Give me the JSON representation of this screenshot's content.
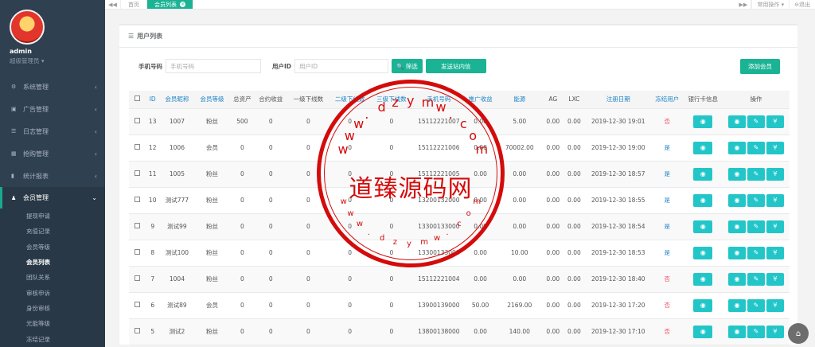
{
  "sidebar": {
    "user": {
      "name": "admin",
      "role": "超级管理员 ▾"
    },
    "nav": [
      {
        "label": "系统管理",
        "icon": "gear-icon",
        "glyph": "⚙",
        "arrow": "‹"
      },
      {
        "label": "广告管理",
        "icon": "image-icon",
        "glyph": "▣",
        "arrow": "‹"
      },
      {
        "label": "日志管理",
        "icon": "list-icon",
        "glyph": "☰",
        "arrow": "‹"
      },
      {
        "label": "抢购管理",
        "icon": "grid-icon",
        "glyph": "▦",
        "arrow": "‹"
      },
      {
        "label": "统计报表",
        "icon": "bar-chart-icon",
        "glyph": "▮",
        "arrow": "‹"
      },
      {
        "label": "会员管理",
        "icon": "user-icon",
        "glyph": "♟",
        "arrow": "⌄"
      }
    ],
    "sub": [
      "提现申请",
      "充值记录",
      "会员等级",
      "会员列表",
      "团队关系",
      "审核申诉",
      "身份审核",
      "光能等级",
      "冻结记录"
    ]
  },
  "topbar": {
    "back": "◀◀",
    "tabs": [
      "首页",
      "会员列表"
    ],
    "forward": "▶▶",
    "ops": "常用操作 ▾",
    "logout": "⊖退出"
  },
  "panel": {
    "title": "用户列表",
    "icon": "☰"
  },
  "filter": {
    "phone_label": "手机号码",
    "phone_placeholder": "手机号码",
    "uid_label": "用户ID",
    "uid_placeholder": "用户ID",
    "search_btn": "🔍 筛选",
    "send_btn": "发送站内信",
    "add_btn": "添加会员"
  },
  "table": {
    "headers": [
      "",
      "ID",
      "会员昵称",
      "会员等级",
      "总资产",
      "合约收益",
      "一级下线数",
      "二级下线数",
      "三级下线数",
      "手机号码",
      "推广收益",
      "能源",
      "AG",
      "LXC",
      "注册日期",
      "冻结用户",
      "银行卡信息",
      "操作"
    ],
    "rows": [
      [
        "13",
        "1007",
        "粉丝",
        "500",
        "0",
        "0",
        "0",
        "0",
        "15112221007",
        "0.00",
        "5.00",
        "0.00",
        "0.00",
        "2019-12-30 19:01",
        "否"
      ],
      [
        "12",
        "1006",
        "会员",
        "0",
        "0",
        "0",
        "0",
        "0",
        "15112221006",
        "0.00",
        "70002.00",
        "0.00",
        "0.00",
        "2019-12-30 19:00",
        "是"
      ],
      [
        "11",
        "1005",
        "粉丝",
        "0",
        "0",
        "0",
        "0",
        "0",
        "15112221005",
        "0.00",
        "0.00",
        "0.00",
        "0.00",
        "2019-12-30 18:57",
        "是"
      ],
      [
        "10",
        "测试777",
        "粉丝",
        "0",
        "0",
        "0",
        "0",
        "0",
        "13200132000",
        "0.00",
        "0.00",
        "0.00",
        "0.00",
        "2019-12-30 18:55",
        "是"
      ],
      [
        "9",
        "测试99",
        "粉丝",
        "0",
        "0",
        "0",
        "0",
        "0",
        "13300133000",
        "0.00",
        "0.00",
        "0.00",
        "0.00",
        "2019-12-30 18:54",
        "是"
      ],
      [
        "8",
        "测试100",
        "粉丝",
        "0",
        "0",
        "0",
        "0",
        "0",
        "13300133000",
        "0.00",
        "10.00",
        "0.00",
        "0.00",
        "2019-12-30 18:53",
        "是"
      ],
      [
        "7",
        "1004",
        "粉丝",
        "0",
        "0",
        "0",
        "0",
        "0",
        "15112221004",
        "0.00",
        "0.00",
        "0.00",
        "0.00",
        "2019-12-30 18:40",
        "否"
      ],
      [
        "6",
        "测试89",
        "会员",
        "0",
        "0",
        "0",
        "0",
        "0",
        "13900139000",
        "50.00",
        "2169.00",
        "0.00",
        "0.00",
        "2019-12-30 17:20",
        "否"
      ],
      [
        "5",
        "测试2",
        "粉丝",
        "0",
        "0",
        "0",
        "0",
        "0",
        "13800138000",
        "0.00",
        "140.00",
        "0.00",
        "0.00",
        "2019-12-30 17:10",
        "否"
      ]
    ],
    "icons": {
      "view": "◉",
      "edit": "✎",
      "money": "¥"
    }
  },
  "watermark": {
    "main": "道臻源码网",
    "letters_top": [
      "w",
      "w",
      "w",
      ".",
      "d",
      "z",
      "y",
      "m",
      "w",
      ".",
      "c",
      "o",
      "m"
    ],
    "letters_bottom": [
      "w",
      "w",
      "w",
      ".",
      "d",
      "z",
      "y",
      "m",
      "w",
      ".",
      "c",
      "o",
      "m"
    ]
  },
  "fab": "⌂",
  "colors": {
    "accent": "#1ab394",
    "sidebar": "#2f4050",
    "info": "#23c6c8",
    "danger": "#ed5565",
    "link": "#1c84c6",
    "stamp": "#d40b0b"
  }
}
